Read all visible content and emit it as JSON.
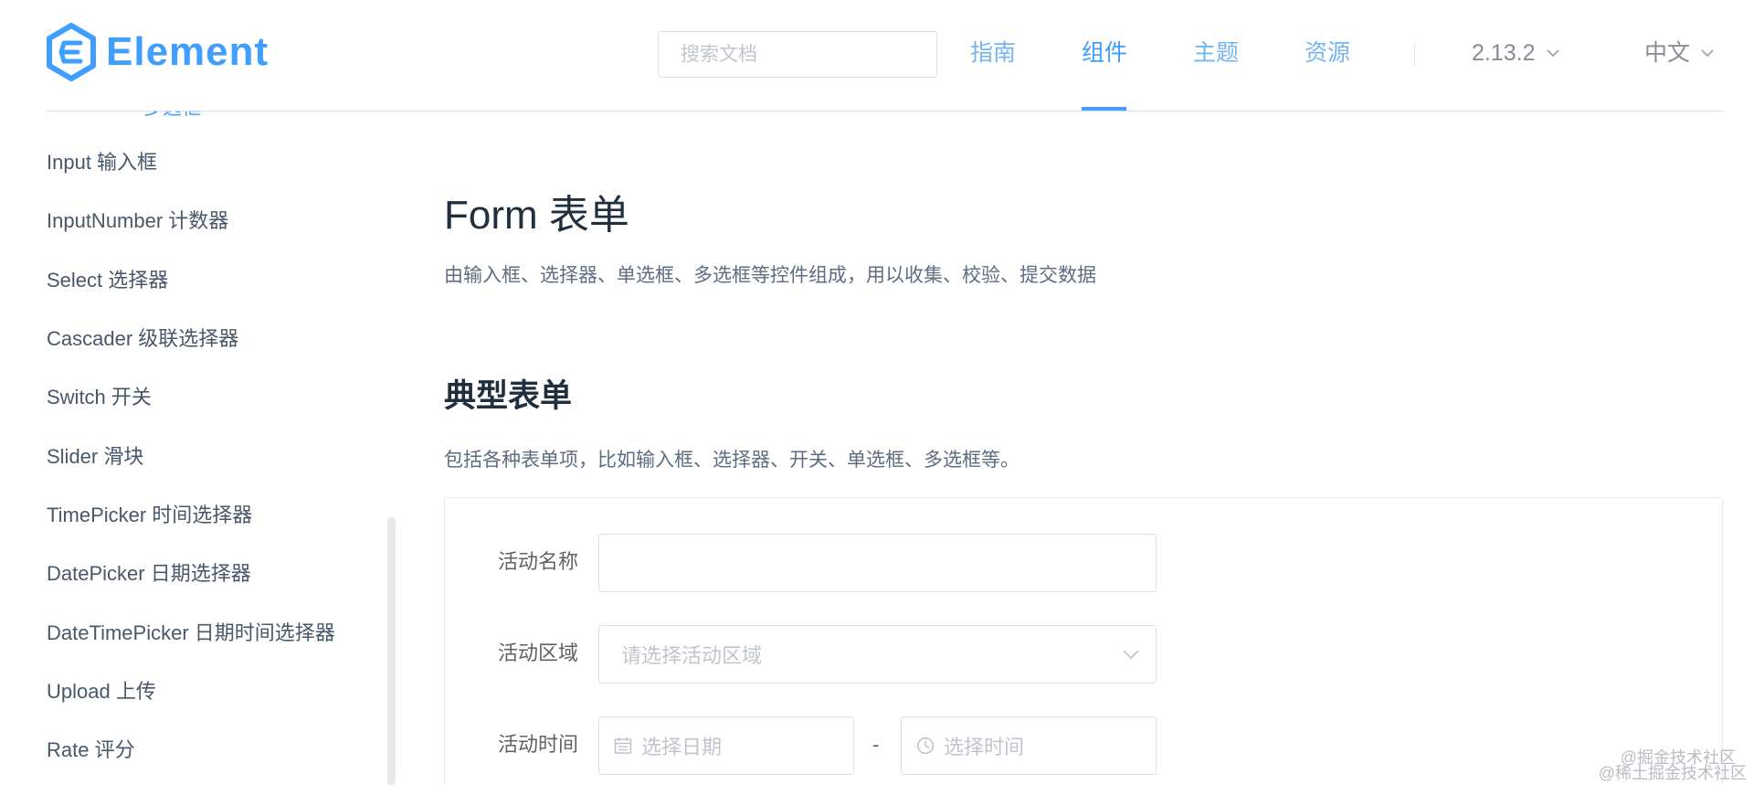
{
  "header": {
    "logo_text": "Element",
    "search": {
      "placeholder": "搜索文档",
      "value": ""
    },
    "nav": [
      {
        "label": "指南",
        "active": false
      },
      {
        "label": "组件",
        "active": true
      },
      {
        "label": "主题",
        "active": false
      },
      {
        "label": "资源",
        "active": false
      }
    ],
    "version": "2.13.2",
    "language": "中文"
  },
  "sidebar": {
    "partial_item": "多选框",
    "items": [
      {
        "label": "Input 输入框"
      },
      {
        "label": "InputNumber 计数器"
      },
      {
        "label": "Select 选择器"
      },
      {
        "label": "Cascader 级联选择器"
      },
      {
        "label": "Switch 开关"
      },
      {
        "label": "Slider 滑块"
      },
      {
        "label": "TimePicker 时间选择器"
      },
      {
        "label": "DatePicker 日期选择器"
      },
      {
        "label": "DateTimePicker 日期时间选择器"
      },
      {
        "label": "Upload 上传"
      },
      {
        "label": "Rate 评分"
      }
    ]
  },
  "main": {
    "title": "Form 表单",
    "description": "由输入框、选择器、单选框、多选框等控件组成，用以收集、校验、提交数据",
    "section_title": "典型表单",
    "section_desc": "包括各种表单项，比如输入框、选择器、开关、单选框、多选框等。",
    "form": {
      "name_label": "活动名称",
      "name_value": "",
      "region_label": "活动区域",
      "region_placeholder": "请选择活动区域",
      "time_label": "活动时间",
      "date_placeholder": "选择日期",
      "separator": "-",
      "time_placeholder": "选择时间"
    }
  },
  "watermarks": [
    "@掘金技术社区",
    "@稀土掘金技术社区"
  ],
  "colors": {
    "primary": "#409eff",
    "text": "#1f2f3d",
    "muted": "#5e6d82",
    "border": "#dcdfe6",
    "placeholder": "#c0c4cc"
  }
}
